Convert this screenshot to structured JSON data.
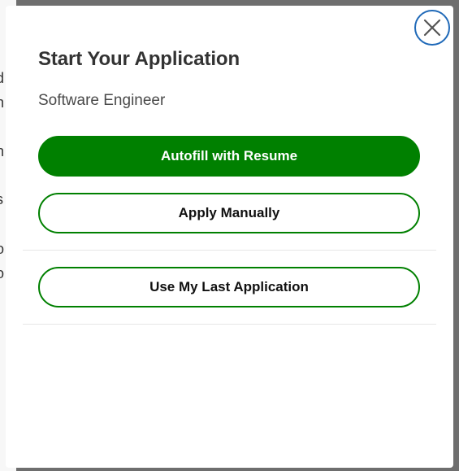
{
  "modal": {
    "title": "Start Your Application",
    "job_title": "Software Engineer",
    "close_icon": "close-icon",
    "buttons": {
      "autofill": "Autofill with Resume",
      "manual": "Apply Manually",
      "last": "Use My Last Application"
    }
  },
  "colors": {
    "primary": "#008000",
    "close_ring": "#1f69b8",
    "overlay": "#6e6e6e"
  }
}
